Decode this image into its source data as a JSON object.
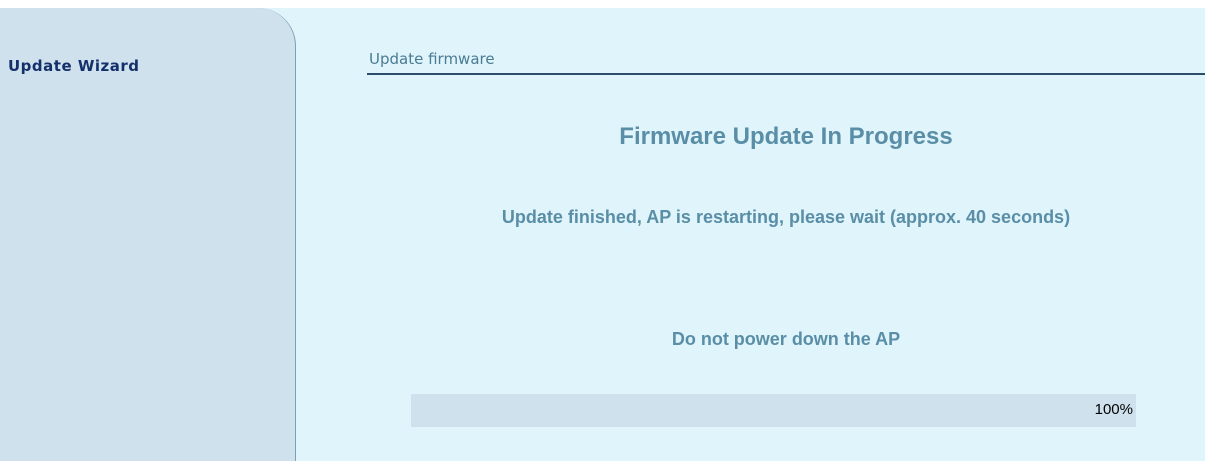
{
  "sidebar": {
    "title": "Update Wizard"
  },
  "main": {
    "section_title": "Update firmware",
    "heading": "Firmware Update In Progress",
    "status_message": "Update finished, AP is restarting, please wait (approx. 40 seconds)",
    "warning": "Do not power down the AP",
    "progress": {
      "value_percent": 100,
      "label": "100%"
    }
  },
  "colors": {
    "content_background": "#dff4fb",
    "sidebar_background": "#cfe1ec",
    "sidebar_title": "#14306b",
    "text_accent": "#5a8ea6",
    "header_rule": "#2c4e6a"
  }
}
